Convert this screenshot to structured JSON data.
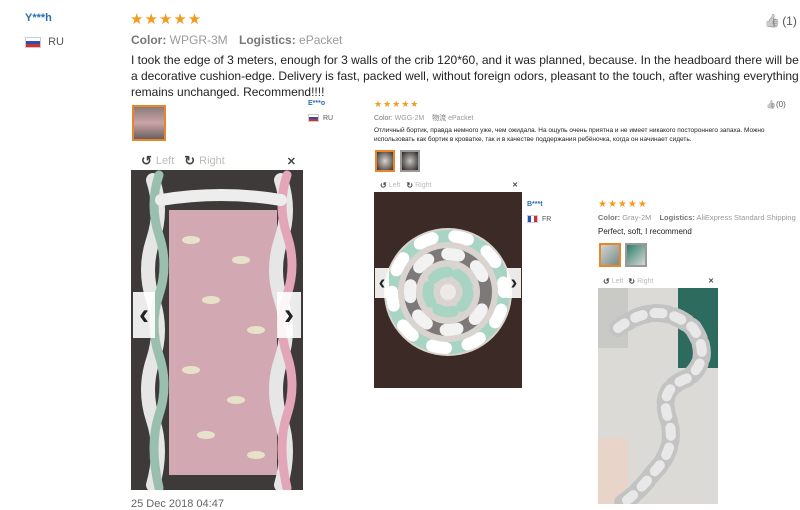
{
  "review1": {
    "user": "Y***h",
    "country": "RU",
    "stars": "★★★★★",
    "color_label": "Color:",
    "color_value": "WPGR-3M",
    "logistics_label": "Logistics:",
    "logistics_value": "ePacket",
    "text": "I took the edge of 3 meters, enough for 3 walls of the crib 120*60, and it was planned, because. In the headboard there will be a decorative cushion-edge. Delivery is fast, packed well, without foreign odors, pleasant to the touch, after washing everything remains unchanged. Recommend!!!!",
    "helpful_count": "(1)",
    "date": "25 Dec 2018 04:47",
    "viewer": {
      "left_label": "Left",
      "right_label": "Right"
    }
  },
  "review2": {
    "user": "E***o",
    "country": "RU",
    "stars": "★★★★★",
    "color_label": "Color:",
    "color_value": "WGG-2M",
    "logistics_label": "物流",
    "logistics_value": "ePacket",
    "text": "Отличный бортик, правда немного уже, чем ожидала. На ощупь очень приятна и не имеет никакого постороннего запаха. Можно использовать как бортик в кроватке, так и в качестве поддержания ребёночка, когда он начинает сидеть.",
    "helpful_count": "(0)",
    "viewer": {
      "left_label": "Left",
      "right_label": "Right"
    }
  },
  "review3": {
    "user": "B***t",
    "country": "FR",
    "stars": "★★★★★",
    "color_label": "Color:",
    "color_value": "Gray-2M",
    "logistics_label": "Logistics:",
    "logistics_value": "AliExpress Standard Shipping",
    "text": "Perfect, soft, I recommend",
    "viewer": {
      "left_label": "Left",
      "right_label": "Right"
    }
  },
  "icons": {
    "rotate_left": "↺",
    "rotate_right": "↻",
    "close": "✕",
    "prev": "‹",
    "next": "›",
    "thumbs_up": "👍"
  },
  "colors": {
    "star": "#f29b1d",
    "username": "#2a6fb0",
    "thumb_selected": "#e8862b"
  }
}
